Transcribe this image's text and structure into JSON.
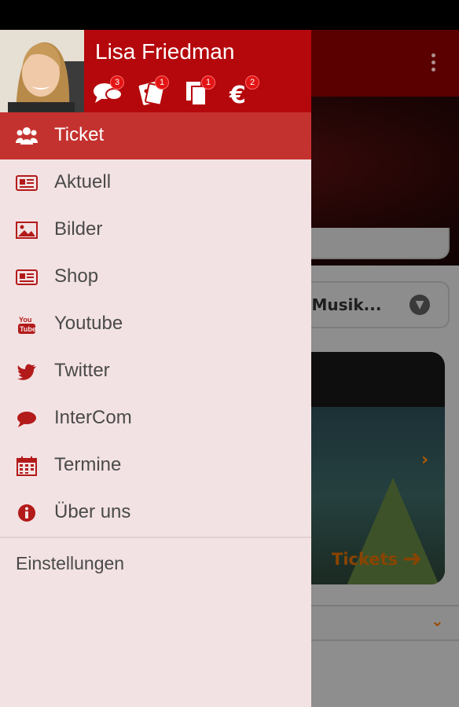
{
  "status_bar": {},
  "drawer": {
    "user": {
      "name": "Lisa Friedman"
    },
    "header_icons": [
      {
        "icon": "chat-icon",
        "badge": "3"
      },
      {
        "icon": "tickets-icon",
        "badge": "1"
      },
      {
        "icon": "documents-icon",
        "badge": "1"
      },
      {
        "icon": "euro-icon",
        "badge": "2"
      }
    ],
    "menu": [
      {
        "label": "Ticket",
        "icon": "group-icon",
        "active": true
      },
      {
        "label": "Aktuell",
        "icon": "newspaper-icon"
      },
      {
        "label": "Bilder",
        "icon": "image-icon"
      },
      {
        "label": "Shop",
        "icon": "newspaper-icon"
      },
      {
        "label": "Youtube",
        "icon": "youtube-icon"
      },
      {
        "label": "Twitter",
        "icon": "twitter-icon"
      },
      {
        "label": "InterCom",
        "icon": "chat-bubble-icon"
      },
      {
        "label": "Termine",
        "icon": "calendar-icon"
      },
      {
        "label": "Über uns",
        "icon": "info-icon"
      }
    ],
    "settings_label": "Einstellungen"
  },
  "background": {
    "select_text": "s, Musik...",
    "tickets_label": "Tickets"
  },
  "colors": {
    "accent": "#b5080c",
    "active_row": "#c4322f",
    "drawer_bg": "#f3e2e3",
    "icon_red": "#b31a1a",
    "text": "#4a4a4a"
  }
}
